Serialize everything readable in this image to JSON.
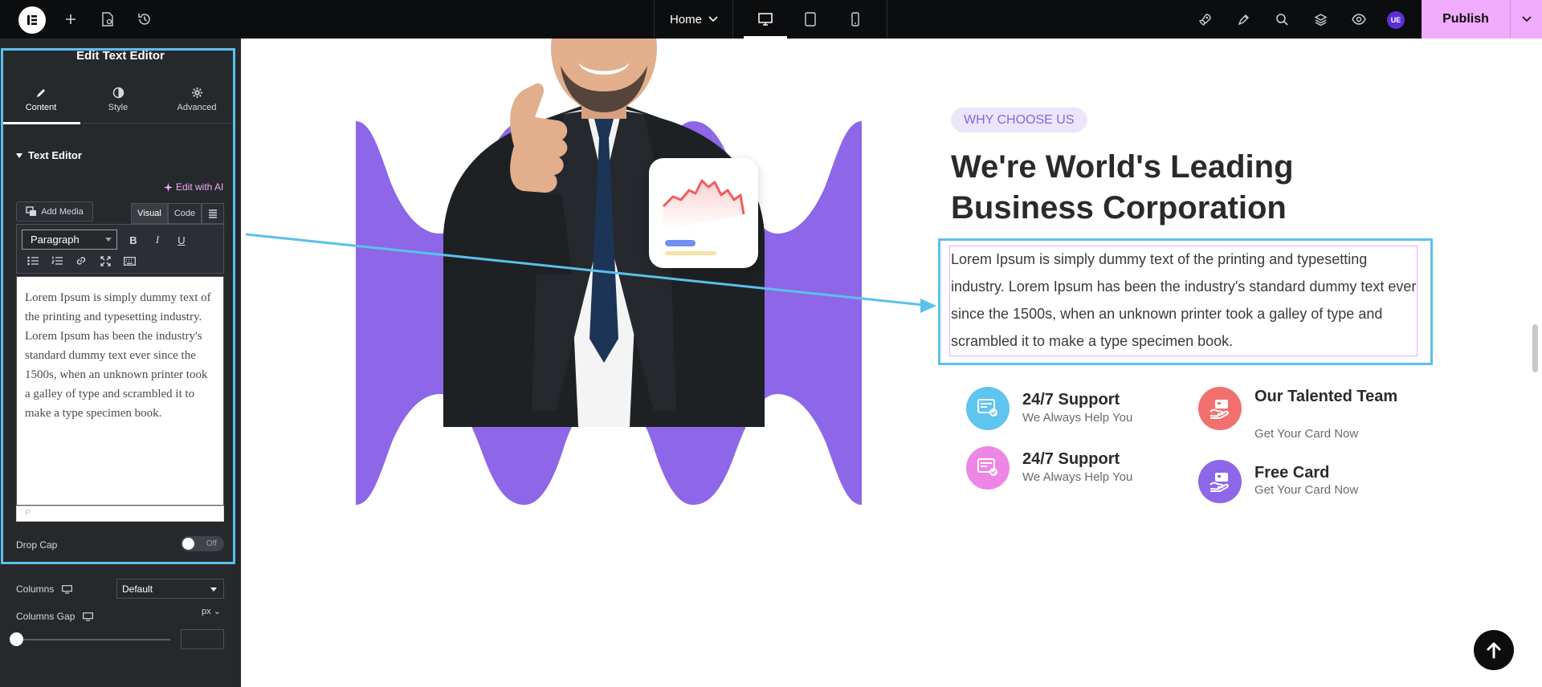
{
  "topbar": {
    "page_name": "Home",
    "avatar_initials": "UE",
    "publish_label": "Publish"
  },
  "panel": {
    "title": "Edit Text Editor",
    "tabs": [
      {
        "label": "Content",
        "icon": "pencil-icon",
        "active": true
      },
      {
        "label": "Style",
        "icon": "contrast-icon",
        "active": false
      },
      {
        "label": "Advanced",
        "icon": "gear-icon",
        "active": false
      }
    ],
    "section_title": "Text Editor",
    "edit_with_ai": "Edit with AI",
    "add_media": "Add Media",
    "mode_visual": "Visual",
    "mode_code": "Code",
    "format_select": "Paragraph",
    "editor_text": "Lorem Ipsum is simply dummy text of the printing and typesetting industry. Lorem Ipsum has been the industry's standard dummy text ever since the 1500s, when an unknown printer took a galley of type and scrambled it to make a type specimen book.",
    "editor_status": "P",
    "drop_cap_label": "Drop Cap",
    "drop_cap_state": "Off",
    "columns_label": "Columns",
    "columns_value": "Default",
    "columns_gap_label": "Columns Gap",
    "columns_gap_unit": "px"
  },
  "canvas": {
    "badge": "WHY CHOOSE US",
    "heading": "We're World's Leading Business Corporation",
    "paragraph": "Lorem Ipsum is simply dummy text of the printing and typesetting industry. Lorem Ipsum has been the industry's standard dummy text ever since the 1500s, when an unknown printer took a galley of type and scrambled it to make a type specimen book.",
    "features": [
      {
        "title": "24/7 Support",
        "subtitle": "We Always Help You",
        "color": "#5ec4f0"
      },
      {
        "title": "Our Talented Team",
        "subtitle": "Get Your Card Now",
        "color": "#f2716e"
      },
      {
        "title": "24/7 Support",
        "subtitle": "We Always Help You",
        "color": "#ee86e6"
      },
      {
        "title": "Free Card",
        "subtitle": "Get Your Card Now",
        "color": "#8d67e8"
      }
    ]
  },
  "colors": {
    "accent_pink": "#f0abfc",
    "selection_blue": "#5bc0eb",
    "wave_purple": "#8d67e8"
  }
}
